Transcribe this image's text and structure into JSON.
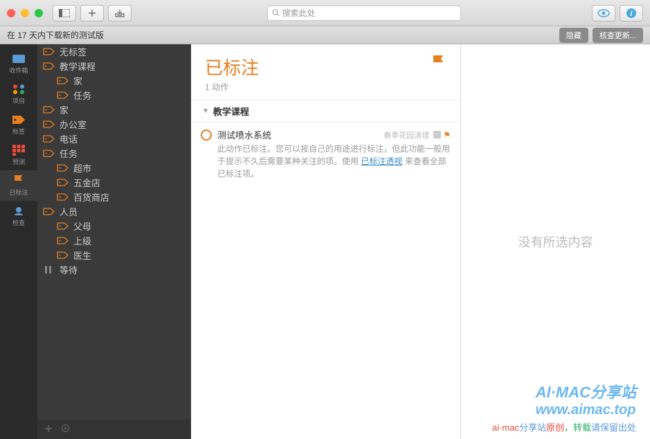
{
  "titlebar": {
    "search_placeholder": "搜索此处"
  },
  "notice": {
    "text": "在 17 天内下载新的测试版",
    "hide": "隐藏",
    "check": "核查更新..."
  },
  "iconbar": [
    {
      "label": "收件箱",
      "name": "inbox"
    },
    {
      "label": "项目",
      "name": "projects"
    },
    {
      "label": "标签",
      "name": "tags"
    },
    {
      "label": "预测",
      "name": "forecast"
    },
    {
      "label": "已标注",
      "name": "flagged",
      "active": true
    },
    {
      "label": "检查",
      "name": "review"
    }
  ],
  "tags": [
    {
      "label": "无标签",
      "level": 1,
      "color": "#e67e22"
    },
    {
      "label": "教学课程",
      "level": 1,
      "color": "#e67e22"
    },
    {
      "label": "家",
      "level": 2,
      "color": "#e67e22"
    },
    {
      "label": "任务",
      "level": 2,
      "color": "#e67e22"
    },
    {
      "label": "家",
      "level": 1,
      "color": "#e67e22"
    },
    {
      "label": "办公室",
      "level": 1,
      "color": "#e67e22"
    },
    {
      "label": "电话",
      "level": 1,
      "color": "#e67e22"
    },
    {
      "label": "任务",
      "level": 1,
      "color": "#e67e22"
    },
    {
      "label": "超市",
      "level": 2,
      "color": "#e67e22"
    },
    {
      "label": "五金店",
      "level": 2,
      "color": "#e67e22"
    },
    {
      "label": "百货商店",
      "level": 2,
      "color": "#e67e22"
    },
    {
      "label": "人员",
      "level": 1,
      "color": "#e67e22"
    },
    {
      "label": "父母",
      "level": 2,
      "color": "#e67e22"
    },
    {
      "label": "上级",
      "level": 2,
      "color": "#e67e22"
    },
    {
      "label": "医生",
      "level": 2,
      "color": "#e67e22"
    },
    {
      "label": "等待",
      "level": 1,
      "color": "#888",
      "pause": true
    }
  ],
  "list": {
    "title": "已标注",
    "subtitle": "1 动作",
    "group": "教学课程",
    "task": {
      "title": "测试喷水系统",
      "project": "春季花园清理",
      "note_a": "此动作已标注。您可以按自己的用途进行标注，但此功能一般用于提示不久后需要某种关注的项。使用 ",
      "link": "已标注透视",
      "note_b": " 来查看全部已标注项。"
    }
  },
  "inspector": {
    "empty": "没有所选内容"
  },
  "watermark": {
    "line1": "AI·MAC分享站",
    "line2": "www.aimac.top",
    "line3_a": "ai·mac",
    "line3_b": "分享站",
    "line3_c": "原创",
    "line3_d": "，转载",
    "line3_e": "请保留出处"
  }
}
